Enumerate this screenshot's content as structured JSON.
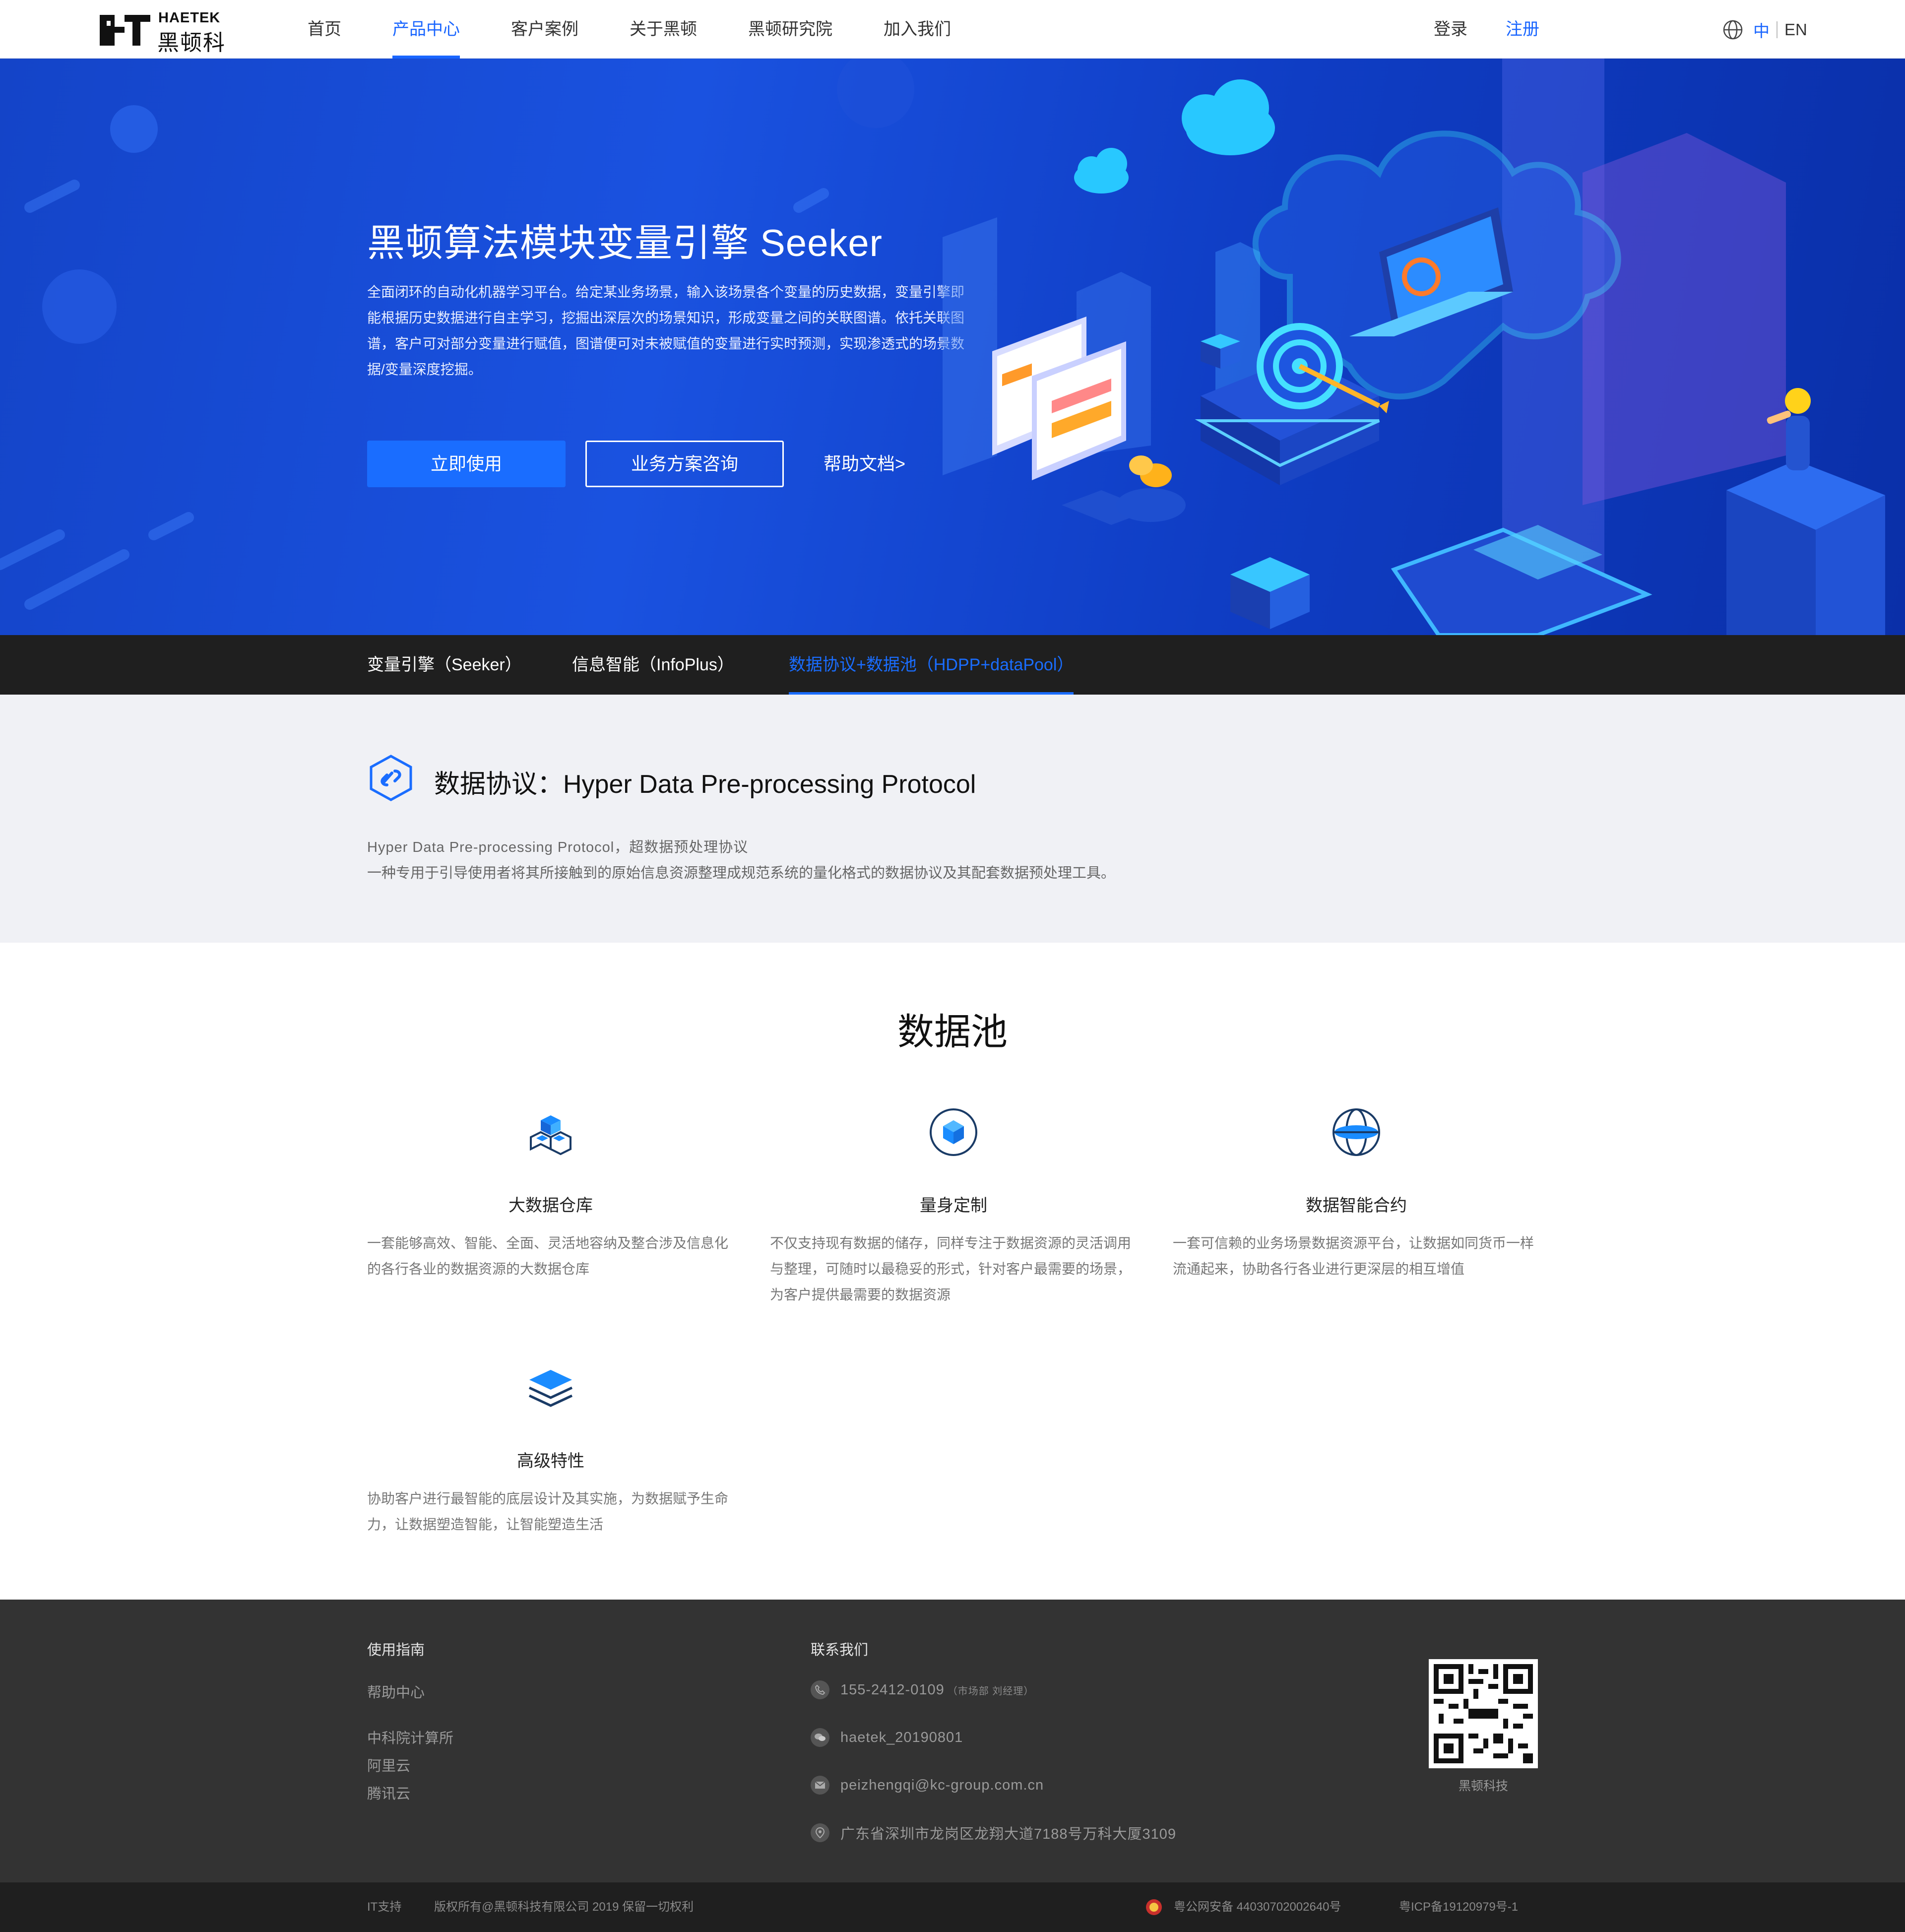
{
  "header": {
    "logo_en": "HAETEK",
    "logo_cn": "黑顿科技",
    "nav": [
      {
        "label": "首页",
        "active": false
      },
      {
        "label": "产品中心",
        "active": true
      },
      {
        "label": "客户案例",
        "active": false
      },
      {
        "label": "关于黑顿",
        "active": false
      },
      {
        "label": "黑顿研究院",
        "active": false
      },
      {
        "label": "加入我们",
        "active": false
      }
    ],
    "login": "登录",
    "register": "注册",
    "lang_cn": "中",
    "lang_en": "EN",
    "accent": "#1a66ff"
  },
  "hero": {
    "title": "黑顿算法模块变量引擎 Seeker",
    "description": "全面闭环的自动化机器学习平台。给定某业务场景，输入该场景各个变量的历史数据，变量引擎即能根据历史数据进行自主学习，挖掘出深层次的场景知识，形成变量之间的关联图谱。依托关联图谱，客户可对部分变量进行赋值，图谱便可对未被赋值的变量进行实时预测，实现渗透式的场景数据/变量深度挖掘。",
    "btn_primary": "立即使用",
    "btn_outline": "业务方案咨询",
    "btn_link": "帮助文档>"
  },
  "tabs": [
    {
      "label": "变量引擎（Seeker）",
      "active": false
    },
    {
      "label": "信息智能（InfoPlus）",
      "active": false
    },
    {
      "label": "数据协议+数据池（HDPP+dataPool）",
      "active": true
    }
  ],
  "protocol": {
    "title": "数据协议：Hyper Data Pre-processing Protocol",
    "line1": "Hyper Data Pre-processing Protocol，超数据预处理协议",
    "line2": "一种专用于引导使用者将其所接触到的原始信息资源整理成规范系统的量化格式的数据协议及其配套数据预处理工具。"
  },
  "pool": {
    "title": "数据池",
    "features": [
      {
        "name": "大数据仓库",
        "icon": "cubes-icon",
        "desc": "一套能够高效、智能、全面、灵活地容纳及整合涉及信息化的各行各业的数据资源的大数据仓库"
      },
      {
        "name": "量身定制",
        "icon": "custom-cube-icon",
        "desc": "不仅支持现有数据的储存，同样专注于数据资源的灵活调用与整理，可随时以最稳妥的形式，针对客户最需要的场景，为客户提供最需要的数据资源"
      },
      {
        "name": "数据智能合约",
        "icon": "globe-contract-icon",
        "desc": "一套可信赖的业务场景数据资源平台，让数据如同货币一样流通起来，协助各行各业进行更深层的相互增值"
      },
      {
        "name": "高级特性",
        "icon": "layers-icon",
        "desc": "协助客户进行最智能的底层设计及其实施，为数据赋予生命力，让数据塑造智能，让智能塑造生活"
      }
    ]
  },
  "footer": {
    "guide_title": "使用指南",
    "guide_links": [
      "帮助中心",
      "中科院计算所",
      "阿里云",
      "腾讯云"
    ],
    "contact_title": "联系我们",
    "phone": "155-2412-0109",
    "phone_note": "（市场部 刘经理）",
    "wechat": "haetek_20190801",
    "email": "peizhengqi@kc-group.com.cn",
    "address": "广东省深圳市龙岗区龙翔大道7188号万科大厦3109",
    "qr_label": "黑顿科技"
  },
  "bottom": {
    "it_support": "IT支持",
    "copyright": "版权所有@黑顿科技有限公司 2019 保留一切权利",
    "police": "粤公网安备 44030702002640号",
    "icp": "粤ICP备19120979号-1"
  }
}
